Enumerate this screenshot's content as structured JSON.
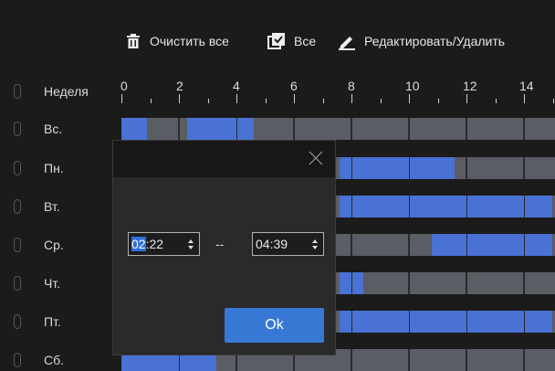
{
  "toolbar": {
    "clear_all_label": "Очистить все",
    "select_all_label": "Все",
    "edit_label": "Редактировать/Удалить"
  },
  "header": {
    "week_label": "Неделя"
  },
  "ticks": [
    "0",
    "2",
    "4",
    "6",
    "8",
    "10",
    "12",
    "14"
  ],
  "days": [
    {
      "label": "Вс.",
      "blue_hours": [
        [
          0,
          0.9
        ],
        [
          2.3,
          4.6
        ]
      ]
    },
    {
      "label": "Пн.",
      "blue_hours": [
        [
          7.6,
          11.6
        ]
      ]
    },
    {
      "label": "Вт.",
      "blue_hours": [
        [
          7.6,
          15
        ]
      ]
    },
    {
      "label": "Ср.",
      "blue_hours": [
        [
          10.8,
          15
        ]
      ]
    },
    {
      "label": "Чт.",
      "blue_hours": [
        [
          7.6,
          8.4
        ]
      ]
    },
    {
      "label": "Пт.",
      "blue_hours": [
        [
          7.6,
          15
        ]
      ]
    },
    {
      "label": "Сб.",
      "blue_hours": [
        [
          0,
          3.3
        ]
      ]
    }
  ],
  "dialog": {
    "start_time_selected": "02",
    "start_time_rest": ":22",
    "separator": "--",
    "end_time": "04:39",
    "ok_label": "Ok"
  },
  "colors": {
    "active": "#4a72d4",
    "inactive": "#5a5d63",
    "button": "#3678d4"
  }
}
